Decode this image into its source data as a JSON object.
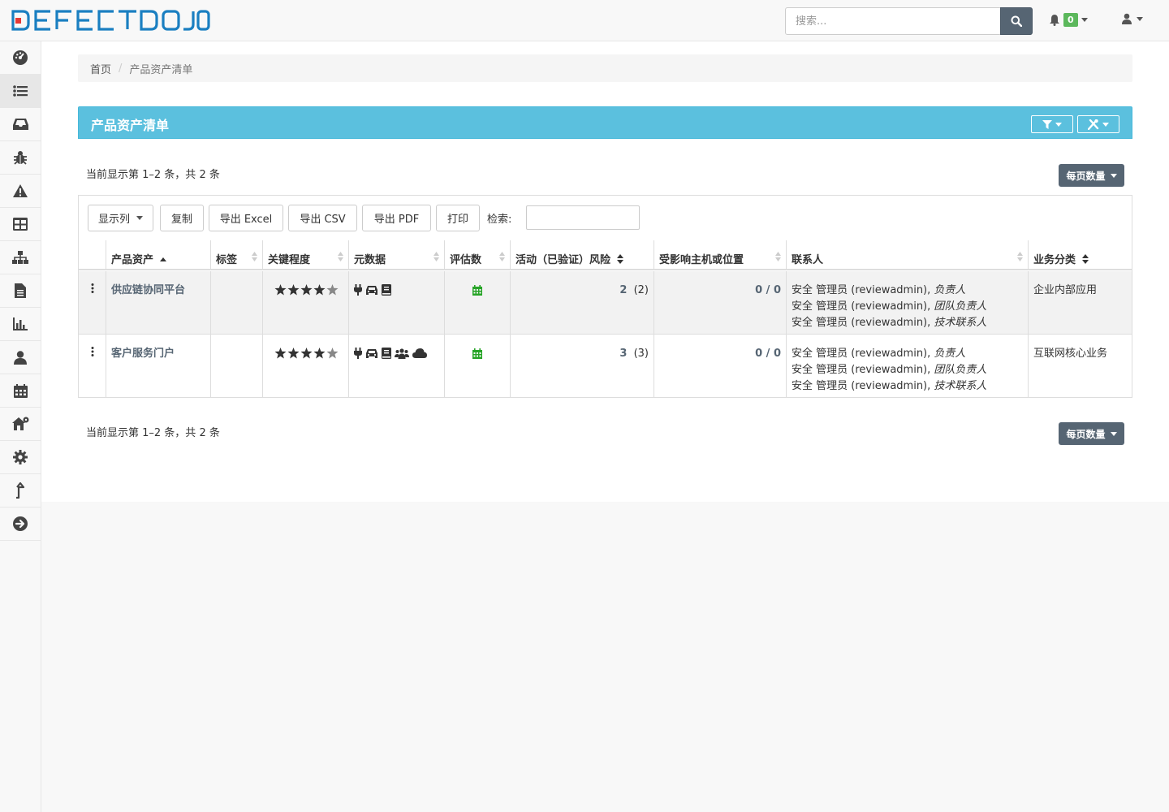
{
  "brand": {
    "logo_text": "DEFECTDOJO",
    "primary": "#1a7fc1",
    "accent": "#e53935"
  },
  "search": {
    "placeholder": "搜索..."
  },
  "notifications": {
    "count": "0"
  },
  "sidebar": {
    "items": [
      {
        "icon": "dashboard-icon"
      },
      {
        "icon": "list-icon",
        "active": true
      },
      {
        "icon": "inbox-icon"
      },
      {
        "icon": "bug-icon"
      },
      {
        "icon": "warning-icon"
      },
      {
        "icon": "table-icon"
      },
      {
        "icon": "sitemap-icon"
      },
      {
        "icon": "file-icon"
      },
      {
        "icon": "bar-chart-icon"
      },
      {
        "icon": "user-icon"
      },
      {
        "icon": "calendar-icon"
      },
      {
        "icon": "home-settings-icon"
      },
      {
        "icon": "gear-icon"
      },
      {
        "icon": "upload-arrow-icon"
      },
      {
        "icon": "arrow-circle-right-icon"
      }
    ]
  },
  "breadcrumb": {
    "home": "首页",
    "current": "产品资产清单"
  },
  "panel": {
    "title": "产品资产清单"
  },
  "info": {
    "top": "当前显示第 1–2 条，共 2 条",
    "bottom": "当前显示第 1–2 条，共 2 条"
  },
  "perpage_label": "每页数量",
  "toolbar": {
    "show_columns": "显示列",
    "copy": "复制",
    "excel": "导出 Excel",
    "csv": "导出 CSV",
    "pdf": "导出 PDF",
    "print": "打印",
    "search_label": "检索:"
  },
  "columns": [
    "产品资产",
    "标签",
    "关键程度",
    "元数据",
    "评估数",
    "活动（已验证）风险",
    "受影响主机或位置",
    "联系人",
    "业务分类"
  ],
  "rows": [
    {
      "name": "供应链协同平台",
      "tags": "",
      "criticality_stars": 4,
      "metadata_icons": [
        "plug-icon",
        "car-icon",
        "book-icon"
      ],
      "risk_active": "2",
      "risk_verified": "(2)",
      "hosts": "0 / 0",
      "contacts": [
        {
          "name": "安全 管理员 (reviewadmin),",
          "role": "负责人"
        },
        {
          "name": "安全 管理员 (reviewadmin),",
          "role": "团队负责人"
        },
        {
          "name": "安全 管理员 (reviewadmin),",
          "role": "技术联系人"
        }
      ],
      "business": "企业内部应用"
    },
    {
      "name": "客户服务门户",
      "tags": "",
      "criticality_stars": 4,
      "metadata_icons": [
        "plug-icon",
        "car-icon",
        "book-icon",
        "users-icon",
        "cloud-icon"
      ],
      "risk_active": "3",
      "risk_verified": "(3)",
      "hosts": "0 / 0",
      "contacts": [
        {
          "name": "安全 管理员 (reviewadmin),",
          "role": "负责人"
        },
        {
          "name": "安全 管理员 (reviewadmin),",
          "role": "团队负责人"
        },
        {
          "name": "安全 管理员 (reviewadmin),",
          "role": "技术联系人"
        }
      ],
      "business": "互联网核心业务"
    }
  ]
}
